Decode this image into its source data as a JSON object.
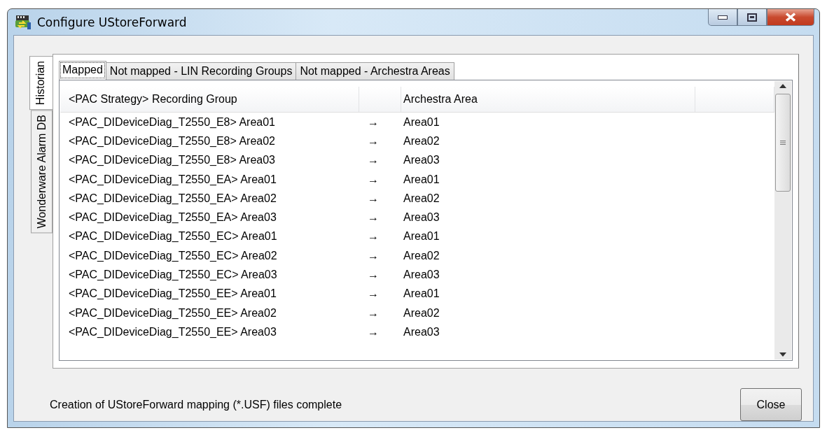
{
  "window": {
    "title": "Configure UStoreForward"
  },
  "side_tabs": [
    {
      "label": "Historian",
      "selected": true
    },
    {
      "label": "Wonderware Alarm DB",
      "selected": false
    }
  ],
  "tabs": [
    {
      "label": "Mapped",
      "selected": true
    },
    {
      "label": "Not mapped - LIN Recording Groups",
      "selected": false
    },
    {
      "label": "Not mapped - Archestra Areas",
      "selected": false
    }
  ],
  "table": {
    "columns": [
      "<PAC Strategy> Recording Group",
      "Archestra Area"
    ],
    "rows": [
      {
        "group": "<PAC_DIDeviceDiag_T2550_E8> Area01",
        "arrow": "→",
        "area": "Area01"
      },
      {
        "group": "<PAC_DIDeviceDiag_T2550_E8> Area02",
        "arrow": "→",
        "area": "Area02"
      },
      {
        "group": "<PAC_DIDeviceDiag_T2550_E8> Area03",
        "arrow": "→",
        "area": "Area03"
      },
      {
        "group": "<PAC_DIDeviceDiag_T2550_EA> Area01",
        "arrow": "→",
        "area": "Area01"
      },
      {
        "group": "<PAC_DIDeviceDiag_T2550_EA> Area02",
        "arrow": "→",
        "area": "Area02"
      },
      {
        "group": "<PAC_DIDeviceDiag_T2550_EA> Area03",
        "arrow": "→",
        "area": "Area03"
      },
      {
        "group": "<PAC_DIDeviceDiag_T2550_EC> Area01",
        "arrow": "→",
        "area": "Area01"
      },
      {
        "group": "<PAC_DIDeviceDiag_T2550_EC> Area02",
        "arrow": "→",
        "area": "Area02"
      },
      {
        "group": "<PAC_DIDeviceDiag_T2550_EC> Area03",
        "arrow": "→",
        "area": "Area03"
      },
      {
        "group": "<PAC_DIDeviceDiag_T2550_EE> Area01",
        "arrow": "→",
        "area": "Area01"
      },
      {
        "group": "<PAC_DIDeviceDiag_T2550_EE> Area02",
        "arrow": "→",
        "area": "Area02"
      },
      {
        "group": "<PAC_DIDeviceDiag_T2550_EE> Area03",
        "arrow": "→",
        "area": "Area03"
      }
    ]
  },
  "status": "Creation of UStoreForward mapping (*.USF) files complete",
  "buttons": [
    "Close"
  ]
}
